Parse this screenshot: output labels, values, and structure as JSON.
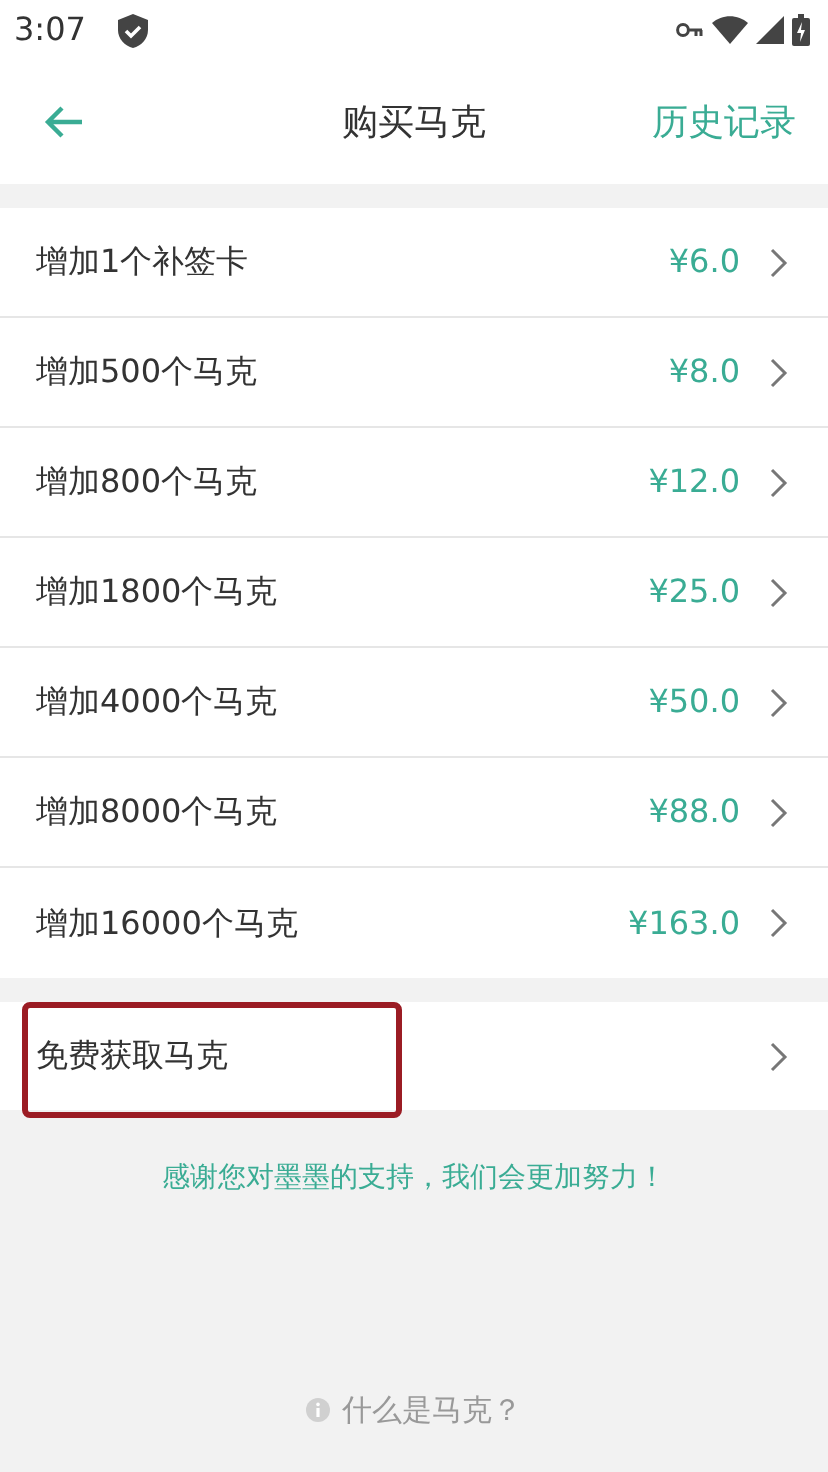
{
  "status_bar": {
    "time": "3:07"
  },
  "header": {
    "title": "购买马克",
    "action": "历史记录"
  },
  "products": [
    {
      "label": "增加1个补签卡",
      "price": "¥6.0"
    },
    {
      "label": "增加500个马克",
      "price": "¥8.0"
    },
    {
      "label": "增加800个马克",
      "price": "¥12.0"
    },
    {
      "label": "增加1800个马克",
      "price": "¥25.0"
    },
    {
      "label": "增加4000个马克",
      "price": "¥50.0"
    },
    {
      "label": "增加8000个马克",
      "price": "¥88.0"
    },
    {
      "label": "增加16000个马克",
      "price": "¥163.0"
    }
  ],
  "free_item": {
    "label": "免费获取马克",
    "highlighted": true
  },
  "thanks": "感谢您对墨墨的支持，我们会更加努力！",
  "help_link": "什么是马克？"
}
